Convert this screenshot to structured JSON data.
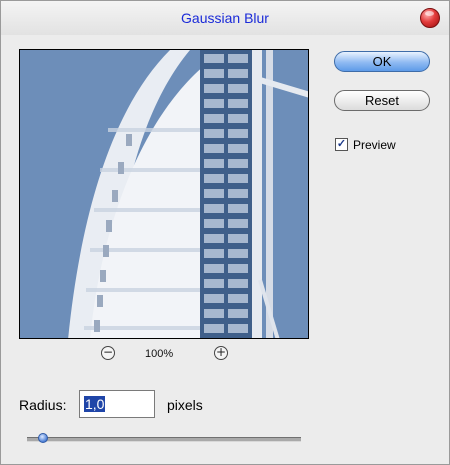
{
  "window": {
    "title": "Gaussian Blur"
  },
  "buttons": {
    "ok_label": "OK",
    "reset_label": "Reset"
  },
  "preview_option": {
    "label": "Preview",
    "checked": true
  },
  "zoom": {
    "level": "100%",
    "zoom_out": "−",
    "zoom_in": "+"
  },
  "radius": {
    "label": "Radius:",
    "value": "1,0",
    "units": "pixels",
    "slider_fraction": 0.06
  },
  "icons": {
    "close": "close-icon",
    "zoom_out": "zoom-out-icon",
    "zoom_in": "zoom-in-icon",
    "checkmark": "checkmark-icon"
  }
}
